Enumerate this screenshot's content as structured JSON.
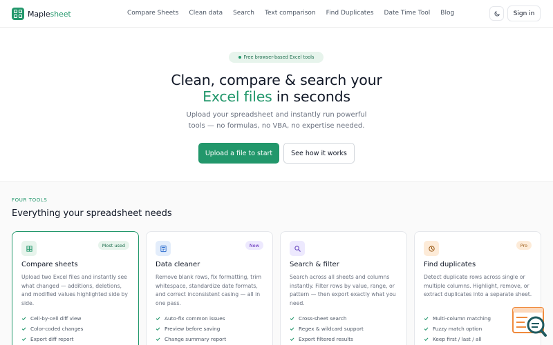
{
  "nav": {
    "logo_a": "Maple",
    "logo_b": "sheet",
    "links": [
      "Compare Sheets",
      "Clean data",
      "Search",
      "Text comparison",
      "Find Duplicates",
      "Date Time Tool",
      "Blog"
    ],
    "theme_icon": "moon-icon",
    "signin": "Sign in"
  },
  "hero": {
    "pill": "Free browser-based Excel tools",
    "title_line1": "Clean, compare & search your",
    "title_green": "Excel files",
    "title_line2_rest": " in seconds",
    "sub_line1": "Upload your spreadsheet and instantly run powerful",
    "sub_line2": "tools — no formulas, no VBA, no expertise needed.",
    "primary_cta": "Upload a file to start",
    "secondary_cta": "See how it works"
  },
  "tools": {
    "kicker": "FOUR TOOLS",
    "title": "Everything your spreadsheet needs",
    "cards": [
      {
        "icon": "table-icon",
        "badge": "Most used",
        "title": "Compare sheets",
        "desc": "Upload two Excel files and instantly see what changed — additions, deletions, and modified values highlighted side by side.",
        "features": [
          "Cell-by-cell diff view",
          "Color-coded changes",
          "Export diff report"
        ]
      },
      {
        "icon": "calculator-icon",
        "badge": "New",
        "title": "Data cleaner",
        "desc": "Remove blank rows, fix formatting, trim whitespace, standardize date formats, and correct inconsistent casing — all in one pass.",
        "features": [
          "Auto-fix common issues",
          "Preview before saving",
          "Change summary report"
        ]
      },
      {
        "icon": "search-icon",
        "badge": "",
        "title": "Search & filter",
        "desc": "Search across all sheets and columns instantly. Filter rows by value, range, or pattern — then export exactly what you need.",
        "features": [
          "Cross-sheet search",
          "Regex & wildcard support",
          "Export filtered results"
        ]
      },
      {
        "icon": "clock-icon",
        "badge": "Pro",
        "title": "Find duplicates",
        "desc": "Detect duplicate rows across single or multiple columns. Highlight, remove, or extract duplicates into a separate sheet.",
        "features": [
          "Multi-column matching",
          "Fuzzy match option",
          "Keep first / last / all"
        ]
      }
    ]
  },
  "colors": {
    "brand": "#22976b",
    "badge_green_bg": "#e7f4ec",
    "badge_purple_bg": "#ede9fe",
    "badge_orange_bg": "#fdebd8"
  },
  "help_widget_icon": "help-chat-search-icon"
}
